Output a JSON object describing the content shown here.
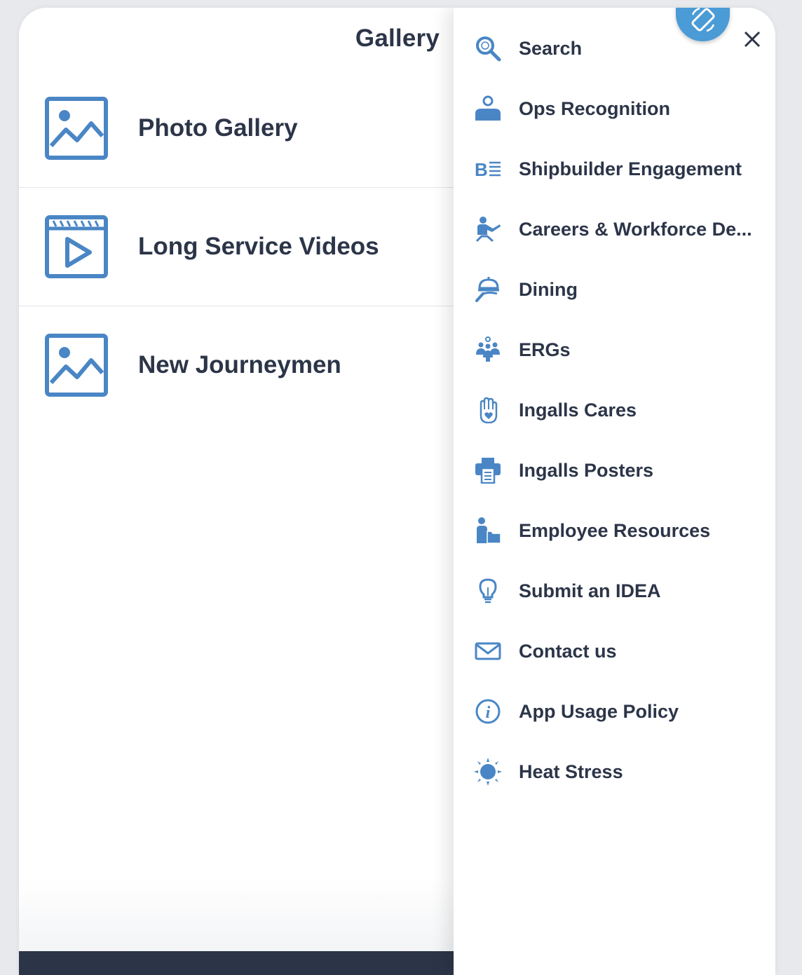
{
  "page": {
    "title": "Gallery"
  },
  "gallery": {
    "items": [
      {
        "label": "Photo Gallery",
        "icon": "image-icon"
      },
      {
        "label": "Long Service Videos",
        "icon": "video-icon"
      },
      {
        "label": "New Journeymen",
        "icon": "image-icon"
      }
    ]
  },
  "drawer": {
    "close_icon": "close-icon",
    "rotate_icon": "rotate-screen-icon",
    "items": [
      {
        "label": "Search",
        "icon": "search-icon"
      },
      {
        "label": "Ops Recognition",
        "icon": "person-icon"
      },
      {
        "label": "Shipbuilder Engagement",
        "icon": "be-list-icon"
      },
      {
        "label": "Careers & Workforce De...",
        "icon": "presenter-icon"
      },
      {
        "label": "Dining",
        "icon": "dining-icon"
      },
      {
        "label": "ERGs",
        "icon": "group-icon"
      },
      {
        "label": "Ingalls Cares",
        "icon": "hand-heart-icon"
      },
      {
        "label": "Ingalls Posters",
        "icon": "printer-icon"
      },
      {
        "label": "Employee Resources",
        "icon": "person-folder-icon"
      },
      {
        "label": "Submit an IDEA",
        "icon": "lightbulb-icon"
      },
      {
        "label": "Contact us",
        "icon": "envelope-icon"
      },
      {
        "label": "App Usage Policy",
        "icon": "info-icon"
      },
      {
        "label": "Heat Stress",
        "icon": "sun-icon"
      }
    ]
  },
  "colors": {
    "accent": "#4a86c5",
    "text": "#2c3548",
    "rotate_button": "#4a9bd6"
  }
}
